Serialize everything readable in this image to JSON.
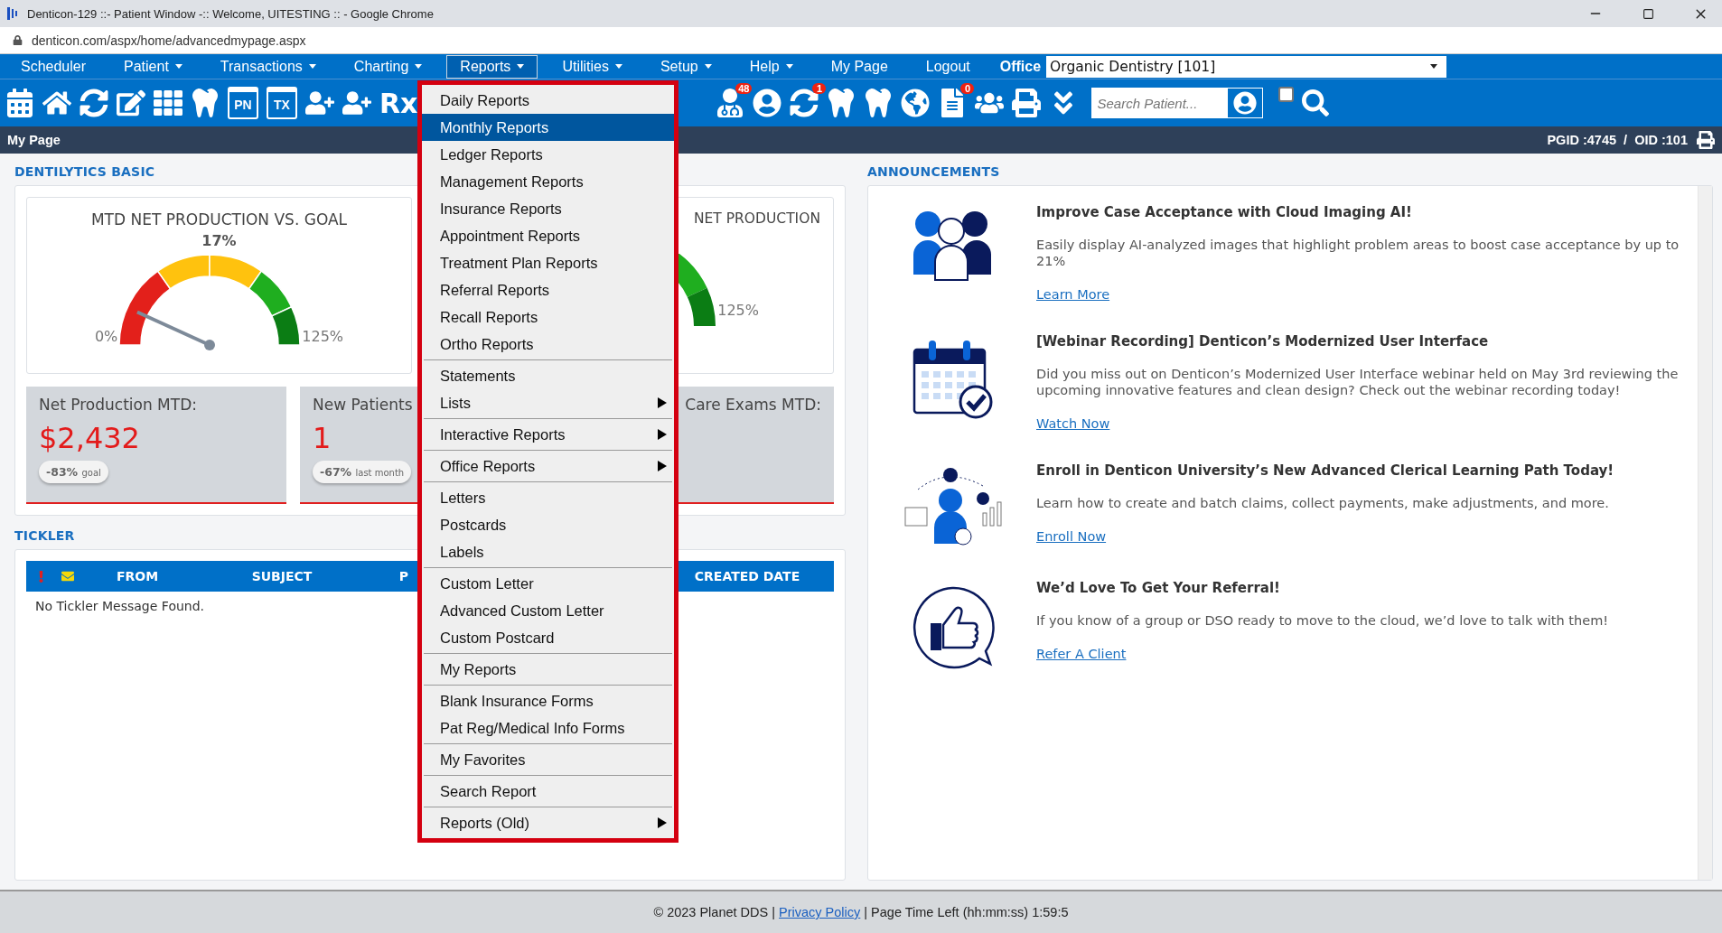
{
  "window": {
    "title": "Denticon-129 ::- Patient Window -:: Welcome, UITESTING :: - Google Chrome",
    "url": "denticon.com/aspx/home/advancedmypage.aspx"
  },
  "nav": {
    "items": [
      {
        "label": "Scheduler",
        "has_menu": false,
        "selected": false
      },
      {
        "label": "Patient",
        "has_menu": true,
        "selected": false
      },
      {
        "label": "Transactions",
        "has_menu": true,
        "selected": false
      },
      {
        "label": "Charting",
        "has_menu": true,
        "selected": false
      },
      {
        "label": "Reports",
        "has_menu": true,
        "selected": true
      },
      {
        "label": "Utilities",
        "has_menu": true,
        "selected": false
      },
      {
        "label": "Setup",
        "has_menu": true,
        "selected": false
      },
      {
        "label": "Help",
        "has_menu": true,
        "selected": false
      },
      {
        "label": "My Page",
        "has_menu": false,
        "selected": false
      },
      {
        "label": "Logout",
        "has_menu": false,
        "selected": false
      }
    ],
    "office_label": "Office",
    "office_value": "Organic Dentistry [101]"
  },
  "toolbar": {
    "left": [
      {
        "kind": "icon"
      },
      {
        "kind": "icon"
      },
      {
        "kind": "icon"
      },
      {
        "kind": "icon"
      },
      {
        "kind": "icon"
      },
      {
        "kind": "icon"
      },
      {
        "kind": "text",
        "label": "PN"
      },
      {
        "kind": "text",
        "label": "TX"
      },
      {
        "kind": "icon"
      },
      {
        "kind": "icon"
      },
      {
        "kind": "rx",
        "label": "Rx"
      }
    ],
    "right": [
      {
        "kind": "badge",
        "badge": "48"
      },
      {
        "kind": "icon"
      },
      {
        "kind": "badge",
        "badge": "1"
      },
      {
        "kind": "icon"
      },
      {
        "kind": "icon"
      },
      {
        "kind": "icon"
      },
      {
        "kind": "badge",
        "badge": "0"
      },
      {
        "kind": "icon"
      },
      {
        "kind": "icon"
      },
      {
        "kind": "icon"
      }
    ],
    "search_placeholder": "Search Patient...",
    "checkbox_checked": false
  },
  "page_bar": {
    "title": "My Page",
    "ids": "PGID :4745  /  OID :101"
  },
  "dentilytics": {
    "heading": "DENTILYTICS BASIC",
    "gauges": [
      {
        "kind": "full",
        "title": "MTD NET PRODUCTION VS. GOAL",
        "reading": "17%",
        "min_label": "0%",
        "max_label": "125%",
        "level": 0.136
      },
      {
        "kind": "partial",
        "title": "NET PRODUCTION",
        "max_label": "125%"
      }
    ],
    "stats": [
      {
        "title": "Net Production MTD:",
        "value": "$2,432",
        "badge_value": "-83%",
        "badge_note": "goal"
      },
      {
        "title": "New Patients",
        "value": "1",
        "badge_value": "-67%",
        "badge_note": "last month"
      },
      {
        "title": "Care Exams MTD:"
      }
    ]
  },
  "tickler": {
    "heading": "TICKLER",
    "columns": [
      "FROM",
      "SUBJECT",
      "P",
      "CREATED DATE"
    ],
    "empty_message": "No Tickler Message Found."
  },
  "reports_menu": {
    "groups": [
      [
        {
          "label": "Daily Reports",
          "selected": false,
          "has_submenu": false
        },
        {
          "label": "Monthly Reports",
          "selected": true,
          "has_submenu": false
        },
        {
          "label": "Ledger Reports",
          "selected": false,
          "has_submenu": false
        },
        {
          "label": "Management Reports",
          "selected": false,
          "has_submenu": false
        },
        {
          "label": "Insurance Reports",
          "selected": false,
          "has_submenu": false
        },
        {
          "label": "Appointment Reports",
          "selected": false,
          "has_submenu": false
        },
        {
          "label": "Treatment Plan Reports",
          "selected": false,
          "has_submenu": false
        },
        {
          "label": "Referral Reports",
          "selected": false,
          "has_submenu": false
        },
        {
          "label": "Recall Reports",
          "selected": false,
          "has_submenu": false
        },
        {
          "label": "Ortho Reports",
          "selected": false,
          "has_submenu": false
        }
      ],
      [
        {
          "label": "Statements",
          "selected": false,
          "has_submenu": false
        },
        {
          "label": "Lists",
          "selected": false,
          "has_submenu": true
        }
      ],
      [
        {
          "label": "Interactive Reports",
          "selected": false,
          "has_submenu": true
        }
      ],
      [
        {
          "label": "Office Reports",
          "selected": false,
          "has_submenu": true
        }
      ],
      [
        {
          "label": "Letters",
          "selected": false,
          "has_submenu": false
        },
        {
          "label": "Postcards",
          "selected": false,
          "has_submenu": false
        },
        {
          "label": "Labels",
          "selected": false,
          "has_submenu": false
        }
      ],
      [
        {
          "label": "Custom Letter",
          "selected": false,
          "has_submenu": false
        },
        {
          "label": "Advanced Custom Letter",
          "selected": false,
          "has_submenu": false
        },
        {
          "label": "Custom Postcard",
          "selected": false,
          "has_submenu": false
        }
      ],
      [
        {
          "label": "My Reports",
          "selected": false,
          "has_submenu": false
        }
      ],
      [
        {
          "label": "Blank Insurance Forms",
          "selected": false,
          "has_submenu": false
        },
        {
          "label": "Pat Reg/Medical Info Forms",
          "selected": false,
          "has_submenu": false
        }
      ],
      [
        {
          "label": "My Favorites",
          "selected": false,
          "has_submenu": false
        }
      ],
      [
        {
          "label": "Search Report",
          "selected": false,
          "has_submenu": false
        }
      ],
      [
        {
          "label": "Reports (Old)",
          "selected": false,
          "has_submenu": true
        }
      ]
    ]
  },
  "announcements": {
    "heading": "ANNOUNCEMENTS",
    "items": [
      {
        "kind": "people",
        "title": "Improve Case Acceptance with Cloud Imaging AI!",
        "body": "Easily display AI-analyzed images that highlight problem areas to boost case acceptance by up to 21%",
        "link": "Learn More"
      },
      {
        "kind": "calendar",
        "title": "[Webinar Recording] Denticon’s Modernized User Interface",
        "body": "Did you miss out on Denticon’s Modernized User Interface webinar held on May 3rd reviewing the upcoming innovative features and clean design? Check out the webinar recording today!",
        "link": "Watch Now"
      },
      {
        "kind": "learning",
        "title": "Enroll in Denticon University’s New Advanced Clerical Learning Path Today!",
        "body": "Learn how to create and batch claims, collect payments, make adjustments, and more.",
        "link": "Enroll Now"
      },
      {
        "kind": "thumbs",
        "title": "We’d Love To Get Your Referral!",
        "body": "If you know of a group or DSO ready to move to the cloud, we’d love to talk with them!",
        "link": "Refer A Client"
      }
    ]
  },
  "footer": {
    "before": "© 2023 Planet DDS |",
    "link": "Privacy Policy",
    "after": "| Page Time Left (hh:mm:ss) 1:59:5"
  }
}
